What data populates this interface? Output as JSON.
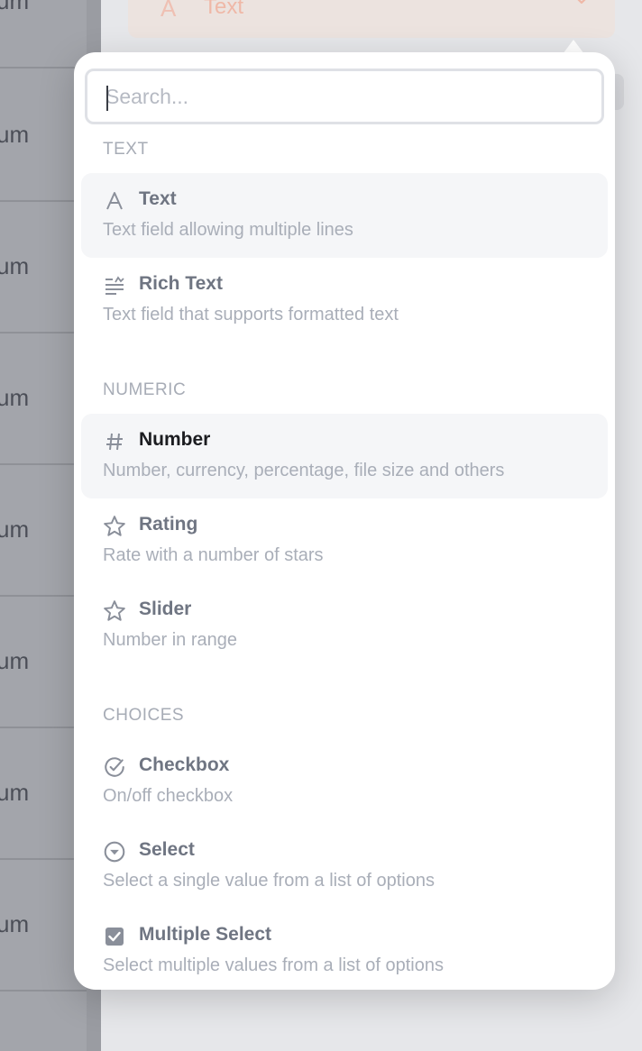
{
  "background": {
    "row_label": "um",
    "type_select": {
      "label": "Text"
    }
  },
  "search": {
    "placeholder": "Search..."
  },
  "sections": {
    "text": {
      "title": "TEXT"
    },
    "numeric": {
      "title": "NUMERIC"
    },
    "choices": {
      "title": "CHOICES"
    }
  },
  "items": {
    "text": {
      "title": "Text",
      "description": "Text field allowing multiple lines",
      "icon": "letter-a-icon"
    },
    "rich_text": {
      "title": "Rich Text",
      "description": "Text field that supports formatted text",
      "icon": "rich-text-icon"
    },
    "number": {
      "title": "Number",
      "description": "Number, currency, percentage, file size and others",
      "icon": "hash-icon"
    },
    "rating": {
      "title": "Rating",
      "description": "Rate with a number of stars",
      "icon": "star-icon"
    },
    "slider": {
      "title": "Slider",
      "description": "Number in range",
      "icon": "star-icon"
    },
    "checkbox": {
      "title": "Checkbox",
      "description": "On/off checkbox",
      "icon": "check-circle-icon"
    },
    "select": {
      "title": "Select",
      "description": "Select a single value from a list of options",
      "icon": "chevron-circle-icon"
    },
    "multi_select": {
      "title": "Multiple Select",
      "description": "Select multiple values from a list of options",
      "icon": "checked-box-icon"
    }
  },
  "colors": {
    "accent": "#efb8a7",
    "icon": "#8a8f9a",
    "active_text": "#1b1c20"
  }
}
